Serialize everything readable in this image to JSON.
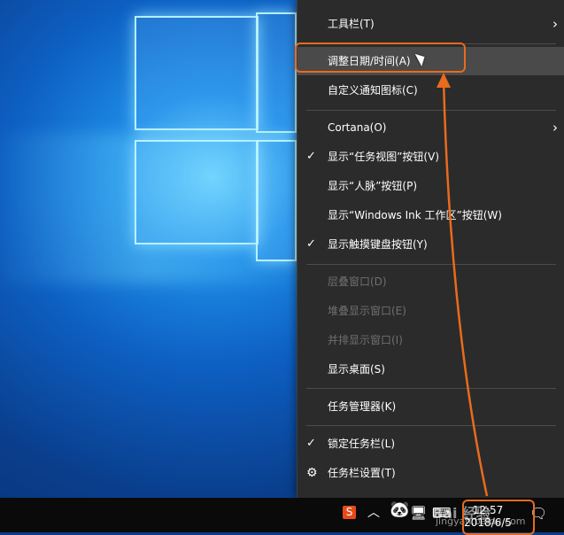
{
  "menu": {
    "items": [
      {
        "label": "工具栏(T)",
        "has_submenu": true
      },
      {
        "label": "调整日期/时间(A)",
        "hover": true
      },
      {
        "label": "自定义通知图标(C)"
      },
      {
        "label": "Cortana(O)",
        "has_submenu": true
      },
      {
        "label": "显示“任务视图”按钮(V)",
        "checked": true
      },
      {
        "label": "显示“人脉”按钮(P)"
      },
      {
        "label": "显示“Windows Ink 工作区”按钮(W)"
      },
      {
        "label": "显示触摸键盘按钮(Y)",
        "checked": true
      },
      {
        "label": "层叠窗口(D)",
        "disabled": true
      },
      {
        "label": "堆叠显示窗口(E)",
        "disabled": true
      },
      {
        "label": "并排显示窗口(I)",
        "disabled": true
      },
      {
        "label": "显示桌面(S)"
      },
      {
        "label": "任务管理器(K)"
      },
      {
        "label": "锁定任务栏(L)",
        "checked": true
      },
      {
        "label": "任务栏设置(T)",
        "icon": "gear-icon"
      }
    ],
    "check_mark": "✓",
    "submenu_arrow": "›",
    "gear_glyph": "⚙"
  },
  "taskbar": {
    "time": "12:57",
    "date": "2018/6/5",
    "sogou_label": "S",
    "up_glyph": "︿",
    "panda_glyph": "🐼",
    "network_glyph": "🖥",
    "keyboard_glyph": "⌨",
    "notification_glyph": "🗨"
  },
  "watermark": {
    "line1": "Bai 经验",
    "line2": "jingyan.baidu.com"
  },
  "colors": {
    "annotation": "#e96b1d",
    "menu_bg": "#2b2b2b",
    "menu_hover": "#4a4a4a",
    "taskbar": "#0a0a0a"
  }
}
